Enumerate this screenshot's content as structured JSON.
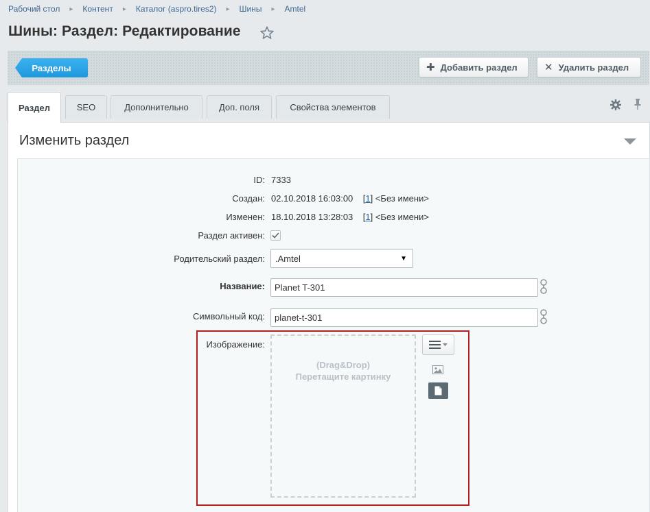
{
  "breadcrumb": [
    "Рабочий стол",
    "Контент",
    "Каталог (aspro.tires2)",
    "Шины",
    "Amtel"
  ],
  "page_title": "Шины: Раздел: Редактирование",
  "toolbar": {
    "sections_label": "Разделы",
    "add_label": "Добавить раздел",
    "delete_label": "Удалить раздел"
  },
  "tabs": [
    {
      "label": "Раздел",
      "active": true
    },
    {
      "label": "SEO"
    },
    {
      "label": "Дополнительно"
    },
    {
      "label": "Доп. поля"
    },
    {
      "label": "Свойства элементов"
    }
  ],
  "section_title": "Изменить раздел",
  "form": {
    "id_label": "ID:",
    "id_value": "7333",
    "created_label": "Создан:",
    "created_value": "02.10.2018 16:03:00",
    "created_user_link": "1",
    "created_user_name": "<Без имени>",
    "modified_label": "Изменен:",
    "modified_value": "18.10.2018 13:28:03",
    "modified_user_link": "1",
    "modified_user_name": "<Без имени>",
    "active_label": "Раздел активен:",
    "active_checked": true,
    "parent_label": "Родительский раздел:",
    "parent_value": ".Amtel",
    "name_label": "Название:",
    "name_value": "Planet T-301",
    "code_label": "Символьный код:",
    "code_value": "planet-t-301",
    "image_label": "Изображение:",
    "dropzone_line1": "(Drag&Drop)",
    "dropzone_line2": "Перетащите картинку"
  },
  "colors": {
    "accent": "#1e97dc",
    "highlight_border": "#b31f1f",
    "link": "#2067b0"
  }
}
